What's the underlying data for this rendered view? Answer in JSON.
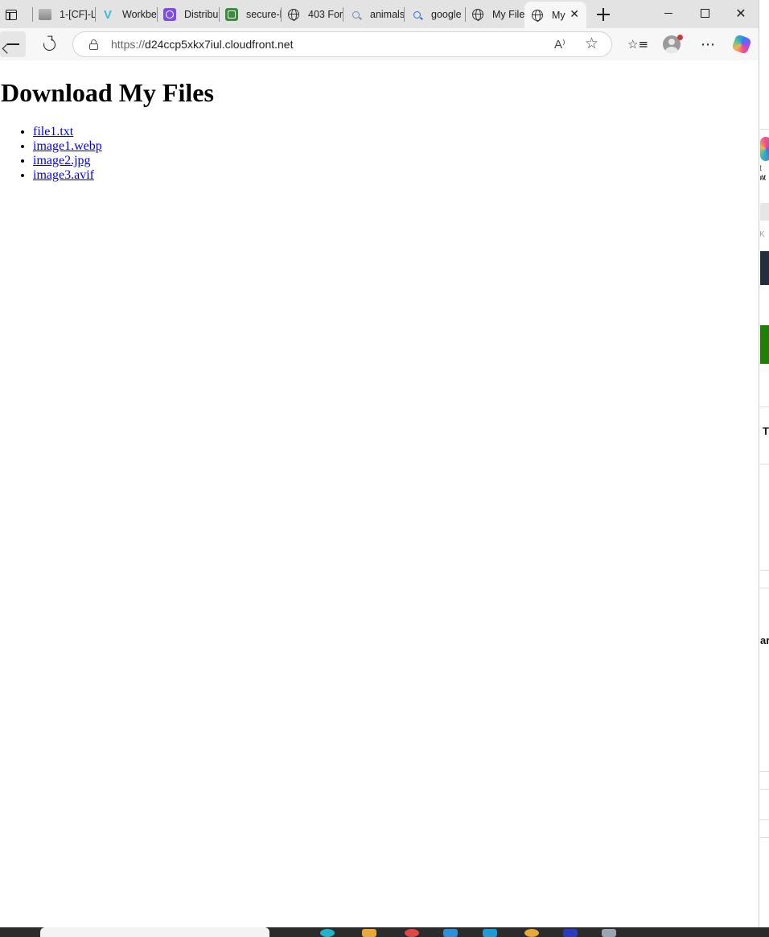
{
  "browser": {
    "tabs": [
      {
        "title": "1-[CF]-L",
        "favicon": "gray-image-icon"
      },
      {
        "title": "Workbe",
        "favicon": "v-logo-icon"
      },
      {
        "title": "Distribu",
        "favicon": "purple-app-icon"
      },
      {
        "title": "secure-l",
        "favicon": "green-app-icon"
      },
      {
        "title": "403 For",
        "favicon": "globe-icon"
      },
      {
        "title": "animals",
        "favicon": "search-icon"
      },
      {
        "title": "google",
        "favicon": "search-icon"
      },
      {
        "title": "My Files",
        "favicon": "globe-icon"
      },
      {
        "title": "My",
        "favicon": "globe-icon",
        "active": true
      }
    ],
    "close_glyph": "✕",
    "url_scheme": "https://",
    "url_host": "d24ccp5xkx7iul.cloudfront.net",
    "read_aloud_glyph": "A⁾",
    "favorite_glyph": "☆",
    "more_glyph": "⋯",
    "favorites_glyph": "☆≡",
    "window_close_glyph": "✕"
  },
  "page": {
    "heading": "Download My Files",
    "files": [
      "file1.txt",
      "image1.webp",
      "image2.jpg",
      "image3.avif"
    ]
  },
  "background_window": {
    "fragments": [
      "t w",
      "nt",
      "K",
      "T",
      "ar"
    ]
  },
  "colors": {
    "link": "#0000ee",
    "tabstrip": "#e3e3e3",
    "toolbar": "#f7f7f7"
  }
}
